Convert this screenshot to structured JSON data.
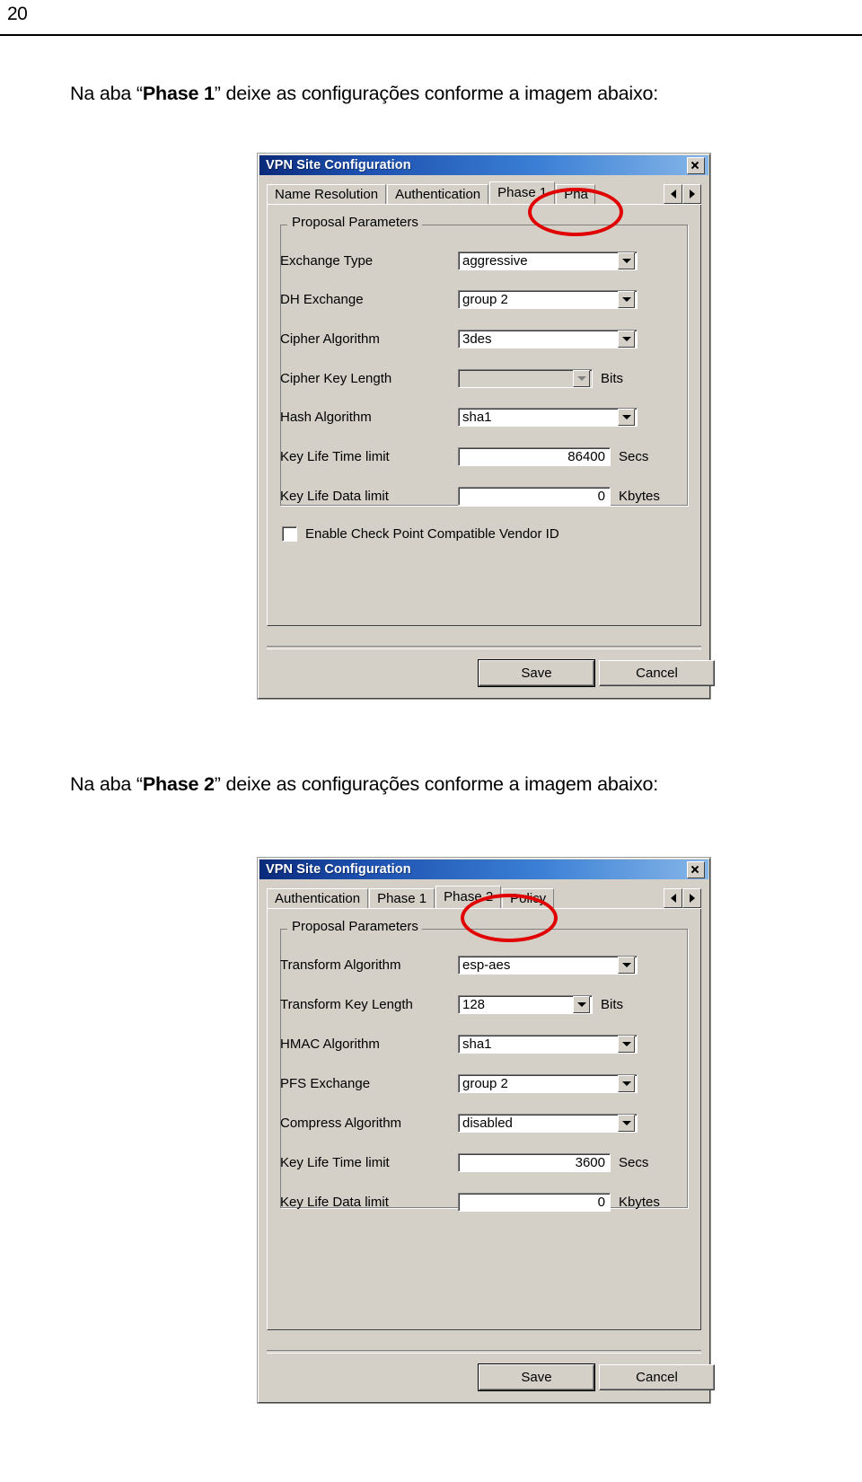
{
  "page": {
    "number": "20"
  },
  "paragraphs": {
    "first": {
      "before": "Na aba “",
      "bold": "Phase 1",
      "after": "” deixe as configurações conforme a imagem abaixo:"
    },
    "second": {
      "before": "Na aba “",
      "bold": "Phase 2",
      "after": "” deixe as configurações conforme a imagem abaixo:"
    }
  },
  "dialog1": {
    "title": "VPN Site Configuration",
    "close_label": "×",
    "tabs": [
      {
        "label": "Name Resolution",
        "active": false
      },
      {
        "label": "Authentication",
        "active": false
      },
      {
        "label": "Phase 1",
        "active": true
      },
      {
        "label": "Pha",
        "active": false
      }
    ],
    "scroll_left": "◄",
    "scroll_right": "►",
    "group_legend": "Proposal Parameters",
    "fields": [
      {
        "label": "Exchange Type",
        "type": "combo",
        "value": "aggressive",
        "unit": "",
        "disabled": false
      },
      {
        "label": "DH Exchange",
        "type": "combo",
        "value": "group 2",
        "unit": "",
        "disabled": false
      },
      {
        "label": "Cipher Algorithm",
        "type": "combo",
        "value": "3des",
        "unit": "",
        "disabled": false
      },
      {
        "label": "Cipher Key Length",
        "type": "combo",
        "value": "",
        "unit": "Bits",
        "disabled": true
      },
      {
        "label": "Hash Algorithm",
        "type": "combo",
        "value": "sha1",
        "unit": "",
        "disabled": false
      },
      {
        "label": "Key Life Time limit",
        "type": "textbox",
        "value": "86400",
        "unit": "Secs",
        "disabled": false
      },
      {
        "label": "Key Life Data limit",
        "type": "textbox",
        "value": "0",
        "unit": "Kbytes",
        "disabled": false
      }
    ],
    "checkbox": {
      "label": "Enable Check Point Compatible Vendor ID",
      "checked": false
    },
    "buttons": {
      "save": "Save",
      "cancel": "Cancel"
    },
    "annotation": {
      "target_tab": "Phase 1",
      "color": "#e00000",
      "shape": "ellipse"
    }
  },
  "dialog2": {
    "title": "VPN Site Configuration",
    "close_label": "×",
    "tabs": [
      {
        "label": "Authentication",
        "active": false
      },
      {
        "label": "Phase 1",
        "active": false
      },
      {
        "label": "Phase 2",
        "active": true
      },
      {
        "label": "Policy",
        "active": false
      }
    ],
    "scroll_left": "◄",
    "scroll_right": "►",
    "group_legend": "Proposal Parameters",
    "fields": [
      {
        "label": "Transform Algorithm",
        "type": "combo",
        "value": "esp-aes",
        "unit": "",
        "disabled": false,
        "narrow": false
      },
      {
        "label": "Transform Key Length",
        "type": "combo",
        "value": "128",
        "unit": "Bits",
        "disabled": false,
        "narrow": true
      },
      {
        "label": "HMAC Algorithm",
        "type": "combo",
        "value": "sha1",
        "unit": "",
        "disabled": false,
        "narrow": false
      },
      {
        "label": "PFS Exchange",
        "type": "combo",
        "value": "group 2",
        "unit": "",
        "disabled": false,
        "narrow": false
      },
      {
        "label": "Compress Algorithm",
        "type": "combo",
        "value": "disabled",
        "unit": "",
        "disabled": false,
        "narrow": false
      },
      {
        "label": "Key Life Time limit",
        "type": "textbox",
        "value": "3600",
        "unit": "Secs",
        "disabled": false,
        "narrow": false
      },
      {
        "label": "Key Life Data limit",
        "type": "textbox",
        "value": "0",
        "unit": "Kbytes",
        "disabled": false,
        "narrow": false
      }
    ],
    "buttons": {
      "save": "Save",
      "cancel": "Cancel"
    },
    "annotation": {
      "target_tab": "Phase 2",
      "color": "#e00000",
      "shape": "ellipse"
    }
  }
}
